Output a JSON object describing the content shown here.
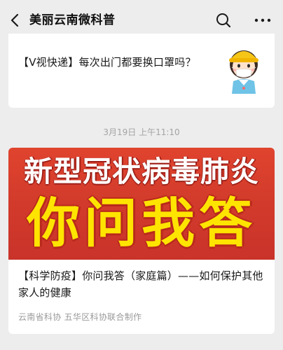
{
  "header": {
    "title": "美丽云南微科普",
    "back_icon": "chevron-left-icon",
    "search_icon": "search-icon",
    "more_icon": "more-horizontal-icon"
  },
  "messages": [
    {
      "title": "【V视快递】每次出门都要换口罩吗？",
      "thumbnail_icon": "child-wearing-mask-icon"
    },
    {
      "timestamp": "3月19日 上午11:10",
      "banner_line1": "新型冠状病毒肺炎",
      "banner_line2": "你问我答",
      "title": "【科学防疫】你问我答（家庭篇）——如何保护其他家人的健康",
      "source": "云南省科协  五华区科协联合制作"
    }
  ],
  "colors": {
    "page_background": "#ededed",
    "banner_red": "#d33b2b",
    "banner_yellow_text": "#ffe400",
    "muted_text": "#9a9a9a"
  }
}
